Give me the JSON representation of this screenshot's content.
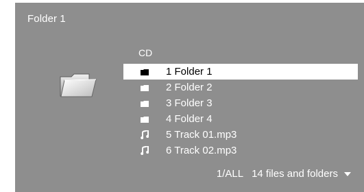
{
  "header": {
    "title": "Folder 1"
  },
  "browser": {
    "path": "CD",
    "items": [
      {
        "label": "1 Folder 1",
        "type": "folder-icon",
        "selected": true
      },
      {
        "label": "2 Folder 2",
        "type": "folder-icon",
        "selected": false
      },
      {
        "label": "3 Folder 3",
        "type": "folder-icon",
        "selected": false
      },
      {
        "label": "4 Folder 4",
        "type": "folder-icon",
        "selected": false
      },
      {
        "label": "5 Track 01.mp3",
        "type": "music-note-icon",
        "selected": false
      },
      {
        "label": "6 Track 02.mp3",
        "type": "music-note-icon",
        "selected": false
      }
    ]
  },
  "footer": {
    "page": "1/ALL",
    "count": "14 files and folders",
    "more_icon": "triangle-down-icon"
  },
  "colors": {
    "panel_background": "#8e8e8e",
    "text": "#ffffff",
    "selected_background": "#ffffff",
    "selected_text": "#000000"
  }
}
